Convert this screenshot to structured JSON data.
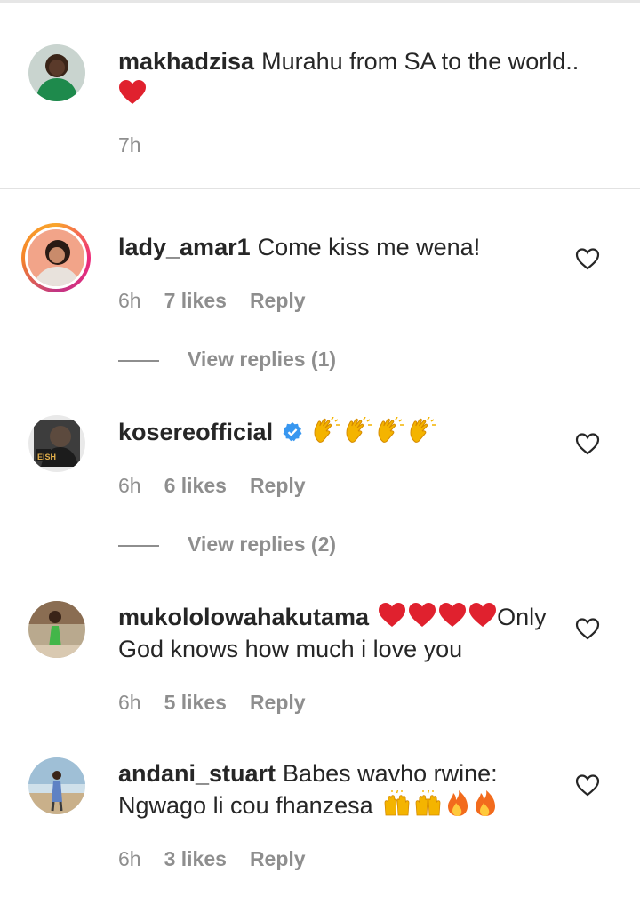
{
  "caption": {
    "username": "makhadzisa",
    "text": "Murahu from SA to the world..",
    "emoji_line": "red-heart",
    "time": "7h"
  },
  "comments": [
    {
      "username": "lady_amar1",
      "text": "Come kiss me wena!",
      "time": "6h",
      "likes": "7 likes",
      "reply": "Reply",
      "view_replies": "View replies (1)",
      "has_story_ring": true
    },
    {
      "username": "kosereofficial",
      "verified": true,
      "text": "",
      "emojis": [
        "clapping-hands",
        "clapping-hands",
        "clapping-hands",
        "clapping-hands"
      ],
      "time": "6h",
      "likes": "6 likes",
      "reply": "Reply",
      "view_replies": "View replies (2)",
      "avatar_label": "EISH"
    },
    {
      "username": "mukololowahakutama",
      "text_after_emojis": "Only",
      "text_line2": "God knows how much i love you",
      "emojis": [
        "red-heart",
        "red-heart",
        "red-heart",
        "red-heart"
      ],
      "time": "6h",
      "likes": "5 likes",
      "reply": "Reply"
    },
    {
      "username": "andani_stuart",
      "text": "Babes wavho rwine:",
      "text_line2": "Ngwago li cou fhanzesa",
      "emojis": [
        "raising-hands",
        "raising-hands",
        "fire",
        "fire"
      ],
      "time": "6h",
      "likes": "3 likes",
      "reply": "Reply"
    }
  ],
  "colors": {
    "text": "#262626",
    "secondary": "#8e8e8e",
    "divider": "#e2e2e2",
    "verified_blue": "#3897f0",
    "heart_red": "#e0212e"
  }
}
